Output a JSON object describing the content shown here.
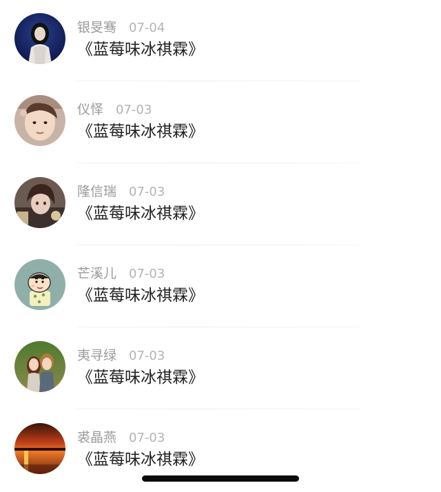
{
  "comments": [
    {
      "name": "银旻骞",
      "date": "07-04",
      "text": "《蓝莓味冰祺霖》",
      "avatar": "avatar-girl-dark-icon"
    },
    {
      "name": "仪怿",
      "date": "07-03",
      "text": "《蓝莓味冰祺霖》",
      "avatar": "avatar-child-face-icon"
    },
    {
      "name": "隆信瑞",
      "date": "07-03",
      "text": "《蓝莓味冰祺霖》",
      "avatar": "avatar-anime-boy-icon"
    },
    {
      "name": "芒溪儿",
      "date": "07-03",
      "text": "《蓝莓味冰祺霖》",
      "avatar": "avatar-cartoon-kid-icon"
    },
    {
      "name": "夷寻绿",
      "date": "07-03",
      "text": "《蓝莓味冰祺霖》",
      "avatar": "avatar-anime-couple-icon"
    },
    {
      "name": "裘晶燕",
      "date": "07-03",
      "text": "《蓝莓味冰祺霖》",
      "avatar": "avatar-sunset-icon"
    }
  ],
  "colors": {
    "name": "#9a9a9a",
    "date": "#b3b3b3",
    "text": "#222222",
    "home_indicator": "#0b0b0b"
  }
}
